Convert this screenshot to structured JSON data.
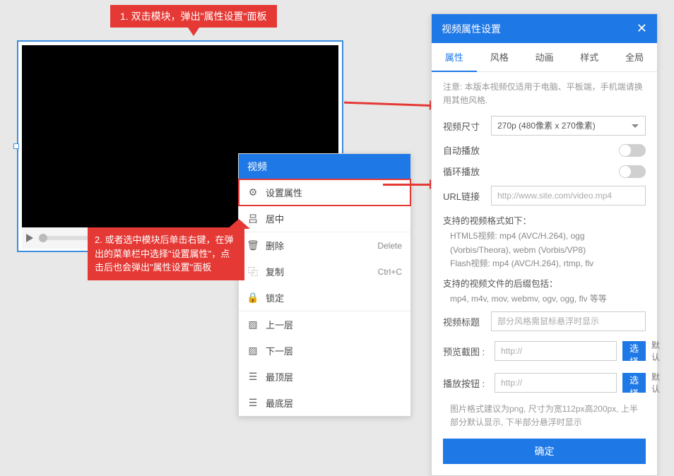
{
  "callout1": "1. 双击模块，弹出\"属性设置\"面板",
  "callout2": "2. 或者选中模块后单击右键，在弹出的菜单栏中选择\"设置属性\"，点击后也会弹出\"属性设置\"面板",
  "ctx": {
    "header": "视频",
    "setProps": "设置属性",
    "center": "居中",
    "delete": "删除",
    "deleteKey": "Delete",
    "copy": "复制",
    "copyKey": "Ctrl+C",
    "lock": "锁定",
    "upLayer": "上一层",
    "downLayer": "下一层",
    "topLayer": "最顶层",
    "bottomLayer": "最底层"
  },
  "panel": {
    "title": "视频属性设置",
    "tabs": {
      "props": "属性",
      "style": "风格",
      "anim": "动画",
      "css": "样式",
      "global": "全局"
    },
    "note": "注意: 本版本视频仅适用于电脑、平板端，手机端请换用其他风格.",
    "sizeLabel": "视频尺寸",
    "sizeValue": "270p (480像素 x 270像素)",
    "autoplay": "自动播放",
    "loop": "循环播放",
    "urlLabel": "URL链接",
    "urlPlaceholder": "http://www.site.com/video.mp4",
    "supportTitle1": "支持的视频格式如下：",
    "supportText1": "HTML5视频: mp4 (AVC/H.264), ogg (Vorbis/Theora), webm (Vorbis/VP8)\nFlash视频: mp4 (AVC/H.264), rtmp, flv",
    "supportTitle2": "支持的视频文件的后缀包括：",
    "supportText2": "mp4, m4v, mov, webmv, ogv, ogg, flv 等等",
    "titleLabel": "视频标题",
    "titlePlaceholder": "部分风格需鼠标悬浮时显示",
    "previewLabel": "预览截图 :",
    "playBtnLabel": "播放按钮 :",
    "httpPlaceholder": "http://",
    "selectBtn": "选择",
    "default": "默认",
    "hint": "图片格式建议为png, 尺寸为宽112px高200px, 上半部分默认显示, 下半部分悬浮时显示",
    "ok": "确定"
  }
}
